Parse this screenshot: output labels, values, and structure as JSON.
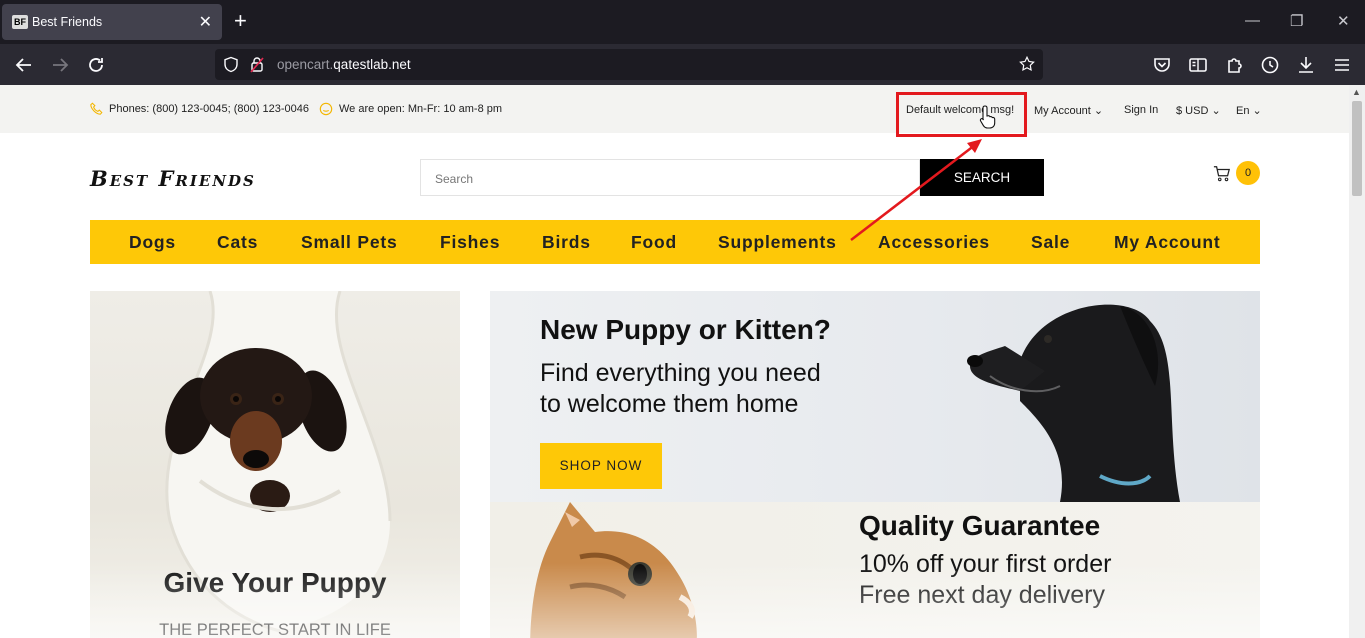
{
  "browser": {
    "tab_title": "Best Friends",
    "tab_favicon": "BF",
    "url_prefix": "opencart.",
    "url_domain": "qatestlab.net",
    "icons": [
      "back-icon",
      "forward-icon",
      "reload-icon",
      "shield-icon",
      "lock-icon",
      "star-icon",
      "pocket-icon",
      "reader-icon",
      "extensions-icon",
      "history-icon",
      "download-icon",
      "menu-icon"
    ]
  },
  "topbar": {
    "phones": "Phones: (800) 123-0045; (800) 123-0046",
    "hours": "We are open: Mn-Fr: 10 am-8 pm",
    "welcome": "Default welcome msg!",
    "my_account": "My Account",
    "sign_in": "Sign In",
    "currency": "$ USD",
    "language": "En"
  },
  "header": {
    "logo": "Best Friends",
    "search_placeholder": "Search",
    "search_button": "SEARCH",
    "cart_count": "0"
  },
  "menu": {
    "items": [
      "Dogs",
      "Cats",
      "Small Pets",
      "Fishes",
      "Birds",
      "Food",
      "Supplements",
      "Accessories",
      "Sale",
      "My Account"
    ]
  },
  "banners": {
    "left": {
      "title": "Give Your Puppy",
      "subtitle": "THE PERFECT START IN LIFE"
    },
    "right_top": {
      "title": "New Puppy or Kitten?",
      "line1": "Find everything you need",
      "line2": "to welcome them home",
      "button": "SHOP NOW"
    },
    "right_bottom": {
      "title": "Quality Guarantee",
      "line1": "10% off your first order",
      "line2": "Free next day delivery"
    }
  },
  "colors": {
    "accent": "#fec807",
    "annotation": "#e3191e",
    "chrome_dark": "#1c1b22"
  }
}
